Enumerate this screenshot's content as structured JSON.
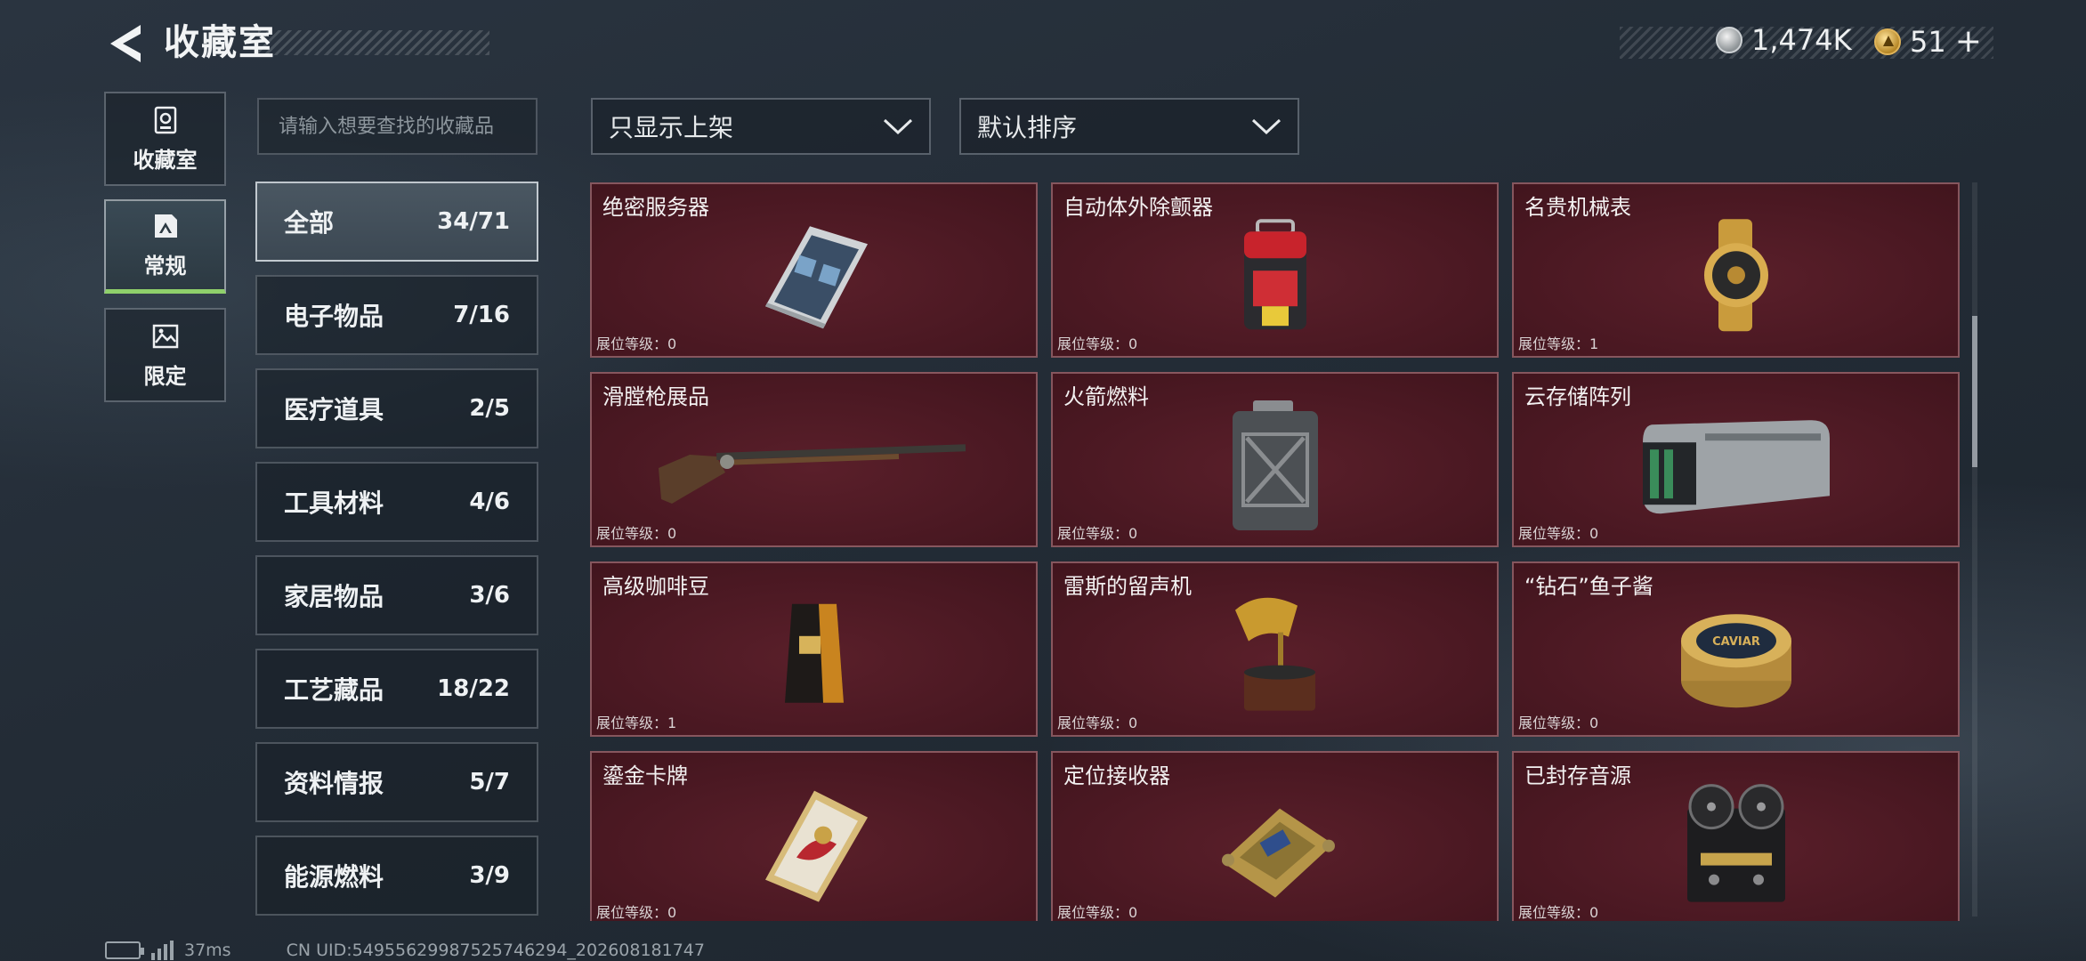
{
  "header": {
    "title": "收藏室",
    "currency_silver": "1,474K",
    "currency_gold": "51",
    "add_label": "+"
  },
  "side_tabs": [
    {
      "label": "收藏室",
      "icon": "display-case-icon"
    },
    {
      "label": "常规",
      "icon": "framed-picture-icon",
      "active": true
    },
    {
      "label": "限定",
      "icon": "landscape-picture-icon"
    }
  ],
  "search": {
    "placeholder": "请输入想要查找的收藏品"
  },
  "categories": [
    {
      "name": "全部",
      "count": "34/71",
      "active": true
    },
    {
      "name": "电子物品",
      "count": "7/16"
    },
    {
      "name": "医疗道具",
      "count": "2/5"
    },
    {
      "name": "工具材料",
      "count": "4/6"
    },
    {
      "name": "家居物品",
      "count": "3/6"
    },
    {
      "name": "工艺藏品",
      "count": "18/22"
    },
    {
      "name": "资料情报",
      "count": "5/7"
    },
    {
      "name": "能源燃料",
      "count": "3/9"
    }
  ],
  "filters": {
    "display_filter": "只显示上架",
    "sort": "默认排序"
  },
  "items": [
    {
      "name": "绝密服务器",
      "level": "展位等级：0",
      "icon": "server-icon"
    },
    {
      "name": "自动体外除颤器",
      "level": "展位等级：0",
      "icon": "defibrillator-icon"
    },
    {
      "name": "名贵机械表",
      "level": "展位等级：1",
      "icon": "watch-icon"
    },
    {
      "name": "滑膛枪展品",
      "level": "展位等级：0",
      "icon": "musket-icon"
    },
    {
      "name": "火箭燃料",
      "level": "展位等级：0",
      "icon": "jerrycan-icon"
    },
    {
      "name": "云存储阵列",
      "level": "展位等级：0",
      "icon": "storage-array-icon"
    },
    {
      "name": "高级咖啡豆",
      "level": "展位等级：1",
      "icon": "coffee-bag-icon"
    },
    {
      "name": "雷斯的留声机",
      "level": "展位等级：0",
      "icon": "gramophone-icon"
    },
    {
      "name": "“钻石”鱼子酱",
      "level": "展位等级：0",
      "icon": "caviar-tin-icon"
    },
    {
      "name": "鎏金卡牌",
      "level": "展位等级：0",
      "icon": "gilded-card-icon"
    },
    {
      "name": "定位接收器",
      "level": "展位等级：0",
      "icon": "gps-receiver-icon"
    },
    {
      "name": "已封存音源",
      "level": "展位等级：0",
      "icon": "reel-recorder-icon"
    }
  ],
  "caviar_label": "CAVIAR",
  "footer": {
    "ping": "37ms",
    "uid": "CN UID:549556299875257462​94_202608181747"
  },
  "colors": {
    "card_bg": "#4a1822",
    "active_tab_underline": "#8fd06b"
  }
}
